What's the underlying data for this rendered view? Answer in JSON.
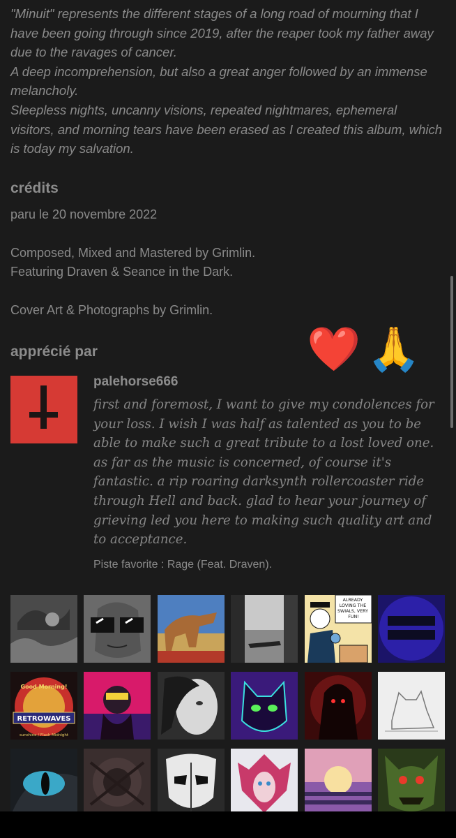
{
  "description": {
    "paragraphs": [
      "\"Minuit\" represents the different stages of a long road of mourning that I have been going through since 2019, after the reaper took my father away due to the ravages of cancer.",
      "A deep incomprehension, but also a great anger followed by an immense melancholy.",
      "Sleepless nights, uncanny visions, repeated nightmares, ephemeral visitors, and morning tears have been erased as I created this album, which is today my salvation."
    ]
  },
  "credits": {
    "heading": "crédits",
    "release_date": "paru le 20 novembre 2022",
    "line1": "Composed, Mixed and Mastered by Grimlin.",
    "line2": "Featuring Draven & Seance in the Dark.",
    "line3": "Cover Art & Photographs by Grimlin."
  },
  "supporters": {
    "heading": "apprécié par",
    "reactions": [
      "❤️",
      "🙏"
    ],
    "featured": {
      "name": "palehorse666",
      "review": "first and foremost, I want to give my condolences for your loss. I wish I was half as talented as you to be able to make such a great tribute to a lost loved one. as far as the music is concerned, of course it's fantastic. a rip roaring darksynth rollercoaster ride through Hell and back. glad to hear your journey of grieving led you here to making such quality art and to acceptance.",
      "favorite_track": "Piste favorite : Rage (Feat. Draven)."
    },
    "avatar_texts": {
      "comic_bubble": "ALREADY LOVING THE SWIALS, VERY FUN!",
      "radio_top": "Good Morning!",
      "radio_main": "RETROWAVES",
      "radio_bottom": "sunshine / Flash Midnight"
    }
  },
  "colors": {
    "background": "#1b1b1b",
    "text": "#8a8a8a",
    "avatar_red": "#d63a34"
  }
}
